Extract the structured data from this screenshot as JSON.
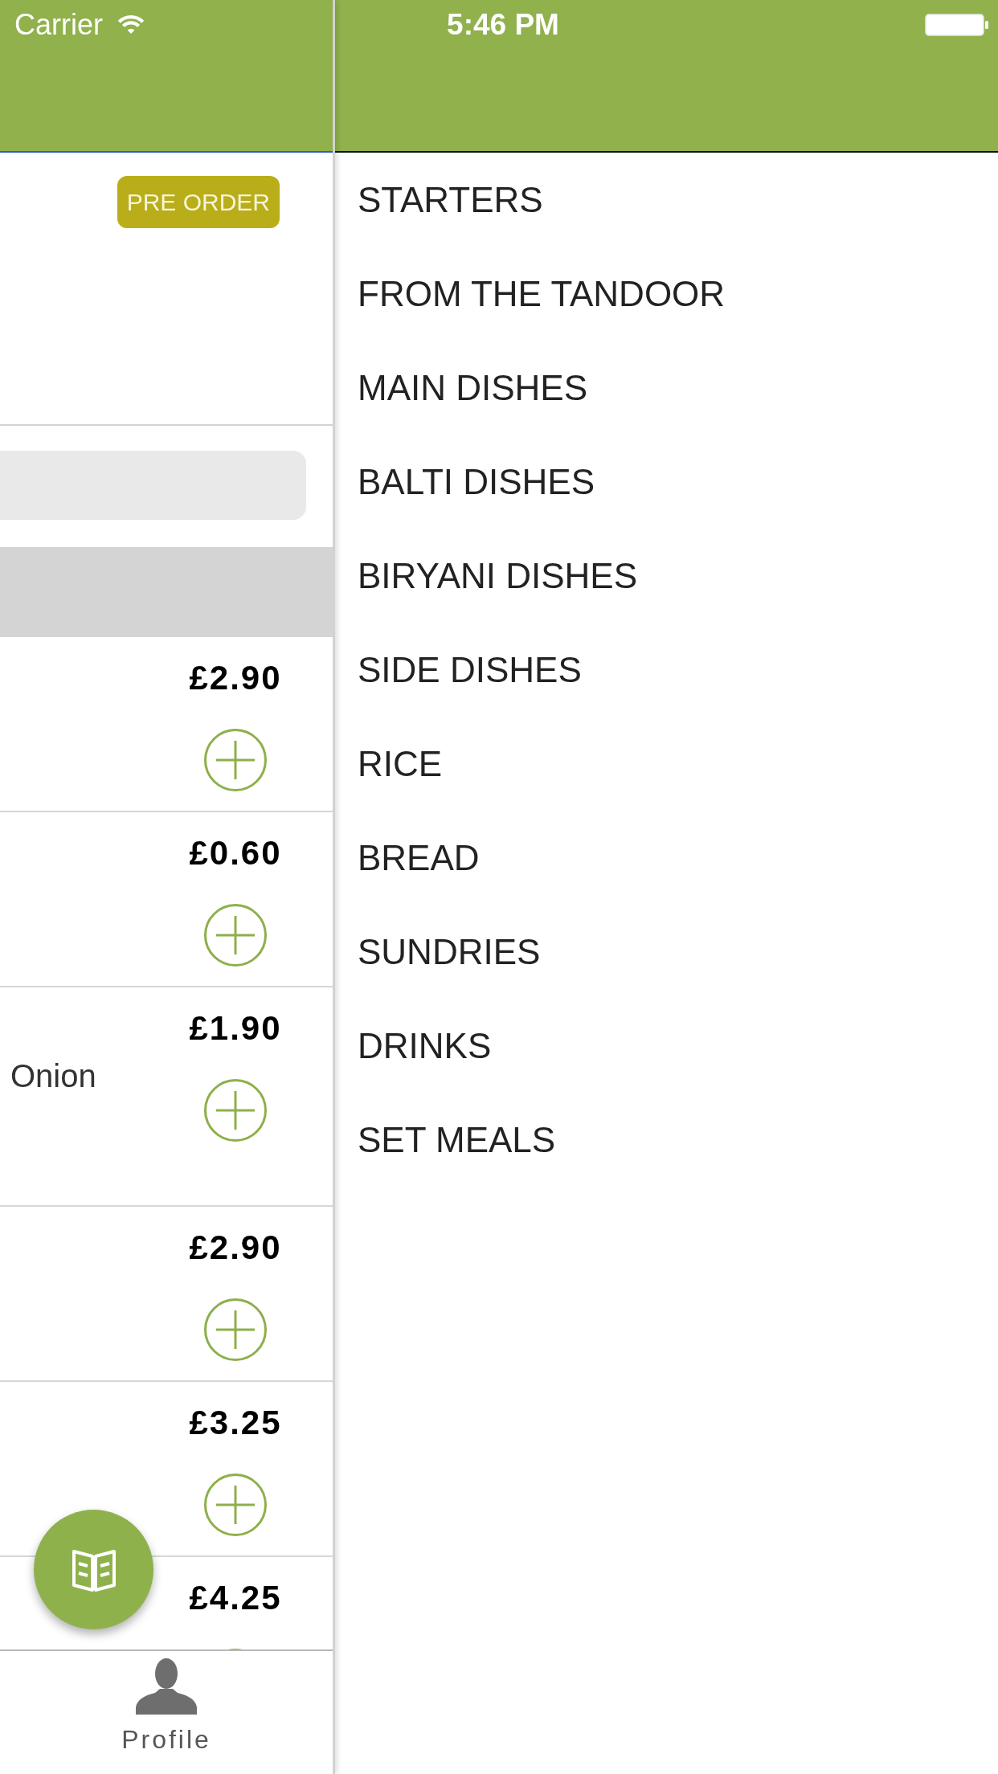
{
  "status_bar": {
    "carrier": "Carrier",
    "time": "5:46 PM"
  },
  "pre_order_button": {
    "label": "PRE ORDER"
  },
  "items": [
    {
      "price": "£2.90"
    },
    {
      "price": "£0.60"
    },
    {
      "text": "Onion",
      "price": "£1.90"
    },
    {
      "price": "£2.90"
    },
    {
      "price": "£3.25"
    },
    {
      "price": "£4.25"
    }
  ],
  "tab_bar": {
    "tabs": [
      {
        "label": "Profile"
      }
    ]
  },
  "menu": {
    "items": [
      {
        "label": "STARTERS"
      },
      {
        "label": "FROM THE TANDOOR"
      },
      {
        "label": "MAIN DISHES"
      },
      {
        "label": "BALTI DISHES"
      },
      {
        "label": "BIRYANI DISHES"
      },
      {
        "label": "SIDE DISHES"
      },
      {
        "label": "RICE"
      },
      {
        "label": "BREAD"
      },
      {
        "label": "SUNDRIES"
      },
      {
        "label": "DRINKS"
      },
      {
        "label": "SET MEALS"
      }
    ]
  }
}
